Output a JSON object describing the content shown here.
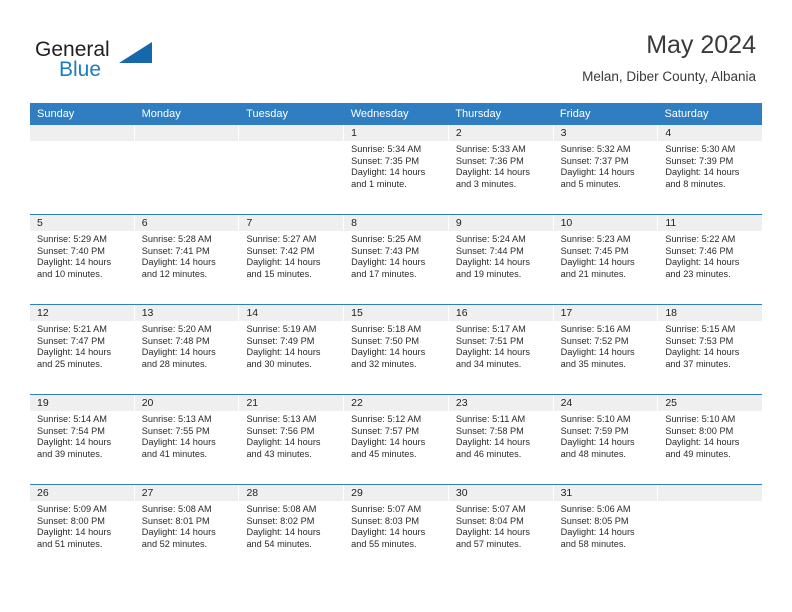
{
  "brand": {
    "name_part1": "General",
    "name_part2": "Blue",
    "logo_icon": "blue-triangle-logo"
  },
  "header": {
    "title": "May 2024",
    "subtitle": "Melan, Diber County, Albania"
  },
  "colors": {
    "header_blue": "#2f7ec1",
    "brand_blue": "#1a7dc4",
    "day_band_gray": "#efefef",
    "text_dark": "#2b2b2b"
  },
  "weekday_headers": [
    "Sunday",
    "Monday",
    "Tuesday",
    "Wednesday",
    "Thursday",
    "Friday",
    "Saturday"
  ],
  "weeks": [
    [
      {
        "day": "",
        "empty": true
      },
      {
        "day": "",
        "empty": true
      },
      {
        "day": "",
        "empty": true
      },
      {
        "day": "1",
        "sunrise": "Sunrise: 5:34 AM",
        "sunset": "Sunset: 7:35 PM",
        "daylight_line1": "Daylight: 14 hours",
        "daylight_line2": "and 1 minute."
      },
      {
        "day": "2",
        "sunrise": "Sunrise: 5:33 AM",
        "sunset": "Sunset: 7:36 PM",
        "daylight_line1": "Daylight: 14 hours",
        "daylight_line2": "and 3 minutes."
      },
      {
        "day": "3",
        "sunrise": "Sunrise: 5:32 AM",
        "sunset": "Sunset: 7:37 PM",
        "daylight_line1": "Daylight: 14 hours",
        "daylight_line2": "and 5 minutes."
      },
      {
        "day": "4",
        "sunrise": "Sunrise: 5:30 AM",
        "sunset": "Sunset: 7:39 PM",
        "daylight_line1": "Daylight: 14 hours",
        "daylight_line2": "and 8 minutes."
      }
    ],
    [
      {
        "day": "5",
        "sunrise": "Sunrise: 5:29 AM",
        "sunset": "Sunset: 7:40 PM",
        "daylight_line1": "Daylight: 14 hours",
        "daylight_line2": "and 10 minutes."
      },
      {
        "day": "6",
        "sunrise": "Sunrise: 5:28 AM",
        "sunset": "Sunset: 7:41 PM",
        "daylight_line1": "Daylight: 14 hours",
        "daylight_line2": "and 12 minutes."
      },
      {
        "day": "7",
        "sunrise": "Sunrise: 5:27 AM",
        "sunset": "Sunset: 7:42 PM",
        "daylight_line1": "Daylight: 14 hours",
        "daylight_line2": "and 15 minutes."
      },
      {
        "day": "8",
        "sunrise": "Sunrise: 5:25 AM",
        "sunset": "Sunset: 7:43 PM",
        "daylight_line1": "Daylight: 14 hours",
        "daylight_line2": "and 17 minutes."
      },
      {
        "day": "9",
        "sunrise": "Sunrise: 5:24 AM",
        "sunset": "Sunset: 7:44 PM",
        "daylight_line1": "Daylight: 14 hours",
        "daylight_line2": "and 19 minutes."
      },
      {
        "day": "10",
        "sunrise": "Sunrise: 5:23 AM",
        "sunset": "Sunset: 7:45 PM",
        "daylight_line1": "Daylight: 14 hours",
        "daylight_line2": "and 21 minutes."
      },
      {
        "day": "11",
        "sunrise": "Sunrise: 5:22 AM",
        "sunset": "Sunset: 7:46 PM",
        "daylight_line1": "Daylight: 14 hours",
        "daylight_line2": "and 23 minutes."
      }
    ],
    [
      {
        "day": "12",
        "sunrise": "Sunrise: 5:21 AM",
        "sunset": "Sunset: 7:47 PM",
        "daylight_line1": "Daylight: 14 hours",
        "daylight_line2": "and 25 minutes."
      },
      {
        "day": "13",
        "sunrise": "Sunrise: 5:20 AM",
        "sunset": "Sunset: 7:48 PM",
        "daylight_line1": "Daylight: 14 hours",
        "daylight_line2": "and 28 minutes."
      },
      {
        "day": "14",
        "sunrise": "Sunrise: 5:19 AM",
        "sunset": "Sunset: 7:49 PM",
        "daylight_line1": "Daylight: 14 hours",
        "daylight_line2": "and 30 minutes."
      },
      {
        "day": "15",
        "sunrise": "Sunrise: 5:18 AM",
        "sunset": "Sunset: 7:50 PM",
        "daylight_line1": "Daylight: 14 hours",
        "daylight_line2": "and 32 minutes."
      },
      {
        "day": "16",
        "sunrise": "Sunrise: 5:17 AM",
        "sunset": "Sunset: 7:51 PM",
        "daylight_line1": "Daylight: 14 hours",
        "daylight_line2": "and 34 minutes."
      },
      {
        "day": "17",
        "sunrise": "Sunrise: 5:16 AM",
        "sunset": "Sunset: 7:52 PM",
        "daylight_line1": "Daylight: 14 hours",
        "daylight_line2": "and 35 minutes."
      },
      {
        "day": "18",
        "sunrise": "Sunrise: 5:15 AM",
        "sunset": "Sunset: 7:53 PM",
        "daylight_line1": "Daylight: 14 hours",
        "daylight_line2": "and 37 minutes."
      }
    ],
    [
      {
        "day": "19",
        "sunrise": "Sunrise: 5:14 AM",
        "sunset": "Sunset: 7:54 PM",
        "daylight_line1": "Daylight: 14 hours",
        "daylight_line2": "and 39 minutes."
      },
      {
        "day": "20",
        "sunrise": "Sunrise: 5:13 AM",
        "sunset": "Sunset: 7:55 PM",
        "daylight_line1": "Daylight: 14 hours",
        "daylight_line2": "and 41 minutes."
      },
      {
        "day": "21",
        "sunrise": "Sunrise: 5:13 AM",
        "sunset": "Sunset: 7:56 PM",
        "daylight_line1": "Daylight: 14 hours",
        "daylight_line2": "and 43 minutes."
      },
      {
        "day": "22",
        "sunrise": "Sunrise: 5:12 AM",
        "sunset": "Sunset: 7:57 PM",
        "daylight_line1": "Daylight: 14 hours",
        "daylight_line2": "and 45 minutes."
      },
      {
        "day": "23",
        "sunrise": "Sunrise: 5:11 AM",
        "sunset": "Sunset: 7:58 PM",
        "daylight_line1": "Daylight: 14 hours",
        "daylight_line2": "and 46 minutes."
      },
      {
        "day": "24",
        "sunrise": "Sunrise: 5:10 AM",
        "sunset": "Sunset: 7:59 PM",
        "daylight_line1": "Daylight: 14 hours",
        "daylight_line2": "and 48 minutes."
      },
      {
        "day": "25",
        "sunrise": "Sunrise: 5:10 AM",
        "sunset": "Sunset: 8:00 PM",
        "daylight_line1": "Daylight: 14 hours",
        "daylight_line2": "and 49 minutes."
      }
    ],
    [
      {
        "day": "26",
        "sunrise": "Sunrise: 5:09 AM",
        "sunset": "Sunset: 8:00 PM",
        "daylight_line1": "Daylight: 14 hours",
        "daylight_line2": "and 51 minutes."
      },
      {
        "day": "27",
        "sunrise": "Sunrise: 5:08 AM",
        "sunset": "Sunset: 8:01 PM",
        "daylight_line1": "Daylight: 14 hours",
        "daylight_line2": "and 52 minutes."
      },
      {
        "day": "28",
        "sunrise": "Sunrise: 5:08 AM",
        "sunset": "Sunset: 8:02 PM",
        "daylight_line1": "Daylight: 14 hours",
        "daylight_line2": "and 54 minutes."
      },
      {
        "day": "29",
        "sunrise": "Sunrise: 5:07 AM",
        "sunset": "Sunset: 8:03 PM",
        "daylight_line1": "Daylight: 14 hours",
        "daylight_line2": "and 55 minutes."
      },
      {
        "day": "30",
        "sunrise": "Sunrise: 5:07 AM",
        "sunset": "Sunset: 8:04 PM",
        "daylight_line1": "Daylight: 14 hours",
        "daylight_line2": "and 57 minutes."
      },
      {
        "day": "31",
        "sunrise": "Sunrise: 5:06 AM",
        "sunset": "Sunset: 8:05 PM",
        "daylight_line1": "Daylight: 14 hours",
        "daylight_line2": "and 58 minutes."
      },
      {
        "day": "",
        "empty": true
      }
    ]
  ]
}
